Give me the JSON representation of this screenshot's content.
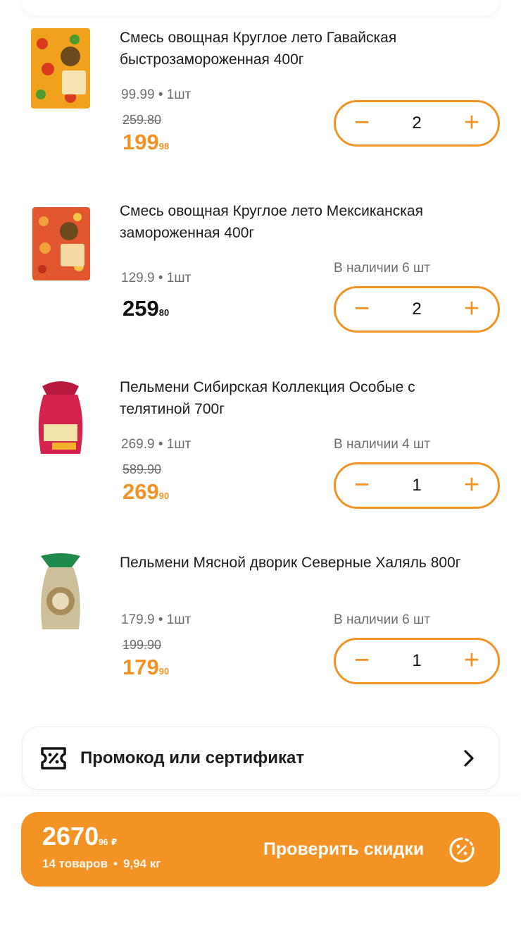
{
  "products": [
    {
      "title": "Смесь овощная Круглое лето Гавайская быстрозамороженная 400г",
      "unit_price": "99.99 • 1шт",
      "old_price": "259.80",
      "price_int": "199",
      "price_cents": "98",
      "price_style": "orange",
      "stock": "",
      "quantity": "2",
      "thumb_color": "#f0a21e"
    },
    {
      "title": "Смесь овощная Круглое лето Мексиканская замороженная 400г",
      "unit_price": "129.9 • 1шт",
      "old_price": "",
      "price_int": "259",
      "price_cents": "80",
      "price_style": "black",
      "stock": "В наличии 6 шт",
      "quantity": "2",
      "thumb_color": "#e2572f"
    },
    {
      "title": "Пельмени Сибирская Коллекция Особые с телятиной 700г",
      "unit_price": "269.9 • 1шт",
      "old_price": "589.90",
      "price_int": "269",
      "price_cents": "90",
      "price_style": "orange",
      "stock": "В наличии 4 шт",
      "quantity": "1",
      "thumb_color": "#d3224d"
    },
    {
      "title": "Пельмени Мясной дворик Северные Халяль 800г",
      "unit_price": "179.9 • 1шт",
      "old_price": "199.90",
      "price_int": "179",
      "price_cents": "90",
      "price_style": "orange",
      "stock": "В наличии 6 шт",
      "quantity": "1",
      "thumb_color": "#1f8a4c"
    }
  ],
  "stepper": {
    "minus": "−",
    "plus": "+"
  },
  "promo": {
    "label": "Промокод или сертификат"
  },
  "checkout": {
    "total_int": "2670",
    "total_cents": "96",
    "currency": "₽",
    "items_count": "14 товаров",
    "separator": "•",
    "weight": "9,94 кг",
    "cta_label": "Проверить скидки"
  },
  "colors": {
    "accent": "#f39325",
    "text": "#1c1c1c",
    "muted": "#6e6e6e"
  }
}
